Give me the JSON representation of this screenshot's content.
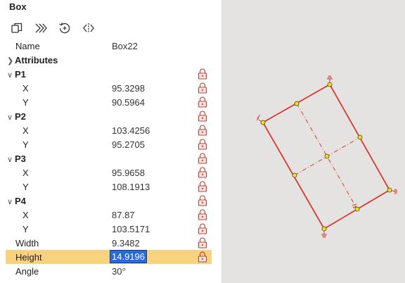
{
  "panel": {
    "title": "Box",
    "toolbar": [
      {
        "name": "copy-icon"
      },
      {
        "name": "fast-forward-icon"
      },
      {
        "name": "rotate-add-icon"
      },
      {
        "name": "mirror-icon"
      }
    ]
  },
  "properties": {
    "name": {
      "label": "Name",
      "value": "Box22"
    },
    "attributes": {
      "label": "Attributes"
    },
    "p1": {
      "label": "P1",
      "x": {
        "label": "X",
        "value": "95.3298"
      },
      "y": {
        "label": "Y",
        "value": "90.5964"
      }
    },
    "p2": {
      "label": "P2",
      "x": {
        "label": "X",
        "value": "103.4256"
      },
      "y": {
        "label": "Y",
        "value": "95.2705"
      }
    },
    "p3": {
      "label": "P3",
      "x": {
        "label": "X",
        "value": "95.9658"
      },
      "y": {
        "label": "Y",
        "value": "108.1913"
      }
    },
    "p4": {
      "label": "P4",
      "x": {
        "label": "X",
        "value": "87.87"
      },
      "y": {
        "label": "Y",
        "value": "103.5171"
      }
    },
    "width": {
      "label": "Width",
      "value": "9.3482"
    },
    "height": {
      "label": "Height",
      "value": "14.9196"
    },
    "angle": {
      "label": "Angle",
      "value": "30°"
    }
  },
  "colors": {
    "selection": "#f9d27f",
    "edit_highlight": "#2a6ad6",
    "shape_stroke": "#d63a2f",
    "handle_fill": "#f5e400",
    "lock": "#c0392b",
    "canvas_bg": "#e4e3e2"
  }
}
